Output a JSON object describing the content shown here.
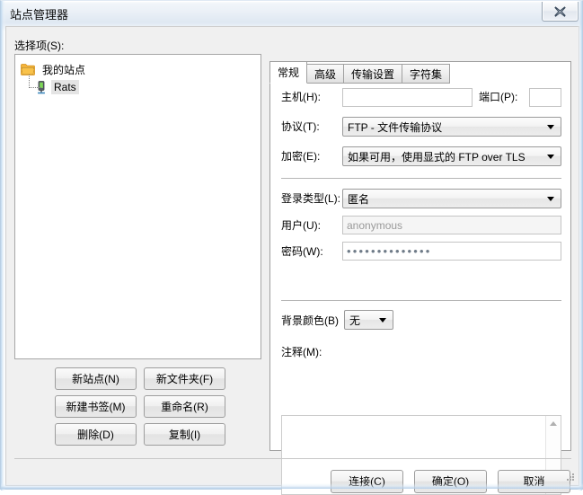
{
  "window": {
    "title": "站点管理器",
    "close_icon": "close-x-icon"
  },
  "left_pane": {
    "label": "选择项(S):",
    "tree": [
      {
        "label": "我的站点",
        "icon": "folder-icon",
        "selected": false
      },
      {
        "label": "Rats",
        "icon": "server-icon",
        "selected": true
      }
    ],
    "buttons": [
      {
        "label": "新站点(N)",
        "name": "new-site-button"
      },
      {
        "label": "新文件夹(F)",
        "name": "new-folder-button"
      },
      {
        "label": "新建书签(M)",
        "name": "new-bookmark-button"
      },
      {
        "label": "重命名(R)",
        "name": "rename-button"
      },
      {
        "label": "删除(D)",
        "name": "delete-button"
      },
      {
        "label": "复制(I)",
        "name": "duplicate-button"
      }
    ]
  },
  "right_pane": {
    "tabs": [
      {
        "label": "常规",
        "active": true
      },
      {
        "label": "高级",
        "active": false
      },
      {
        "label": "传输设置",
        "active": false
      },
      {
        "label": "字符集",
        "active": false
      }
    ],
    "general": {
      "host_label": "主机(H):",
      "host_value": "",
      "port_label": "端口(P):",
      "port_value": "",
      "protocol_label": "协议(T):",
      "protocol_value": "FTP - 文件传输协议",
      "encryption_label": "加密(E):",
      "encryption_value": "如果可用，使用显式的 FTP over TLS",
      "logontype_label": "登录类型(L):",
      "logontype_value": "匿名",
      "user_label": "用户(U):",
      "user_value": "anonymous",
      "password_label": "密码(W):",
      "password_value": "••••••••••••••",
      "bgcolor_label": "背景颜色(B)",
      "bgcolor_value": "无",
      "comments_label": "注释(M):",
      "comments_value": ""
    }
  },
  "footer": {
    "buttons": [
      {
        "label": "连接(C)",
        "name": "connect-button"
      },
      {
        "label": "确定(O)",
        "name": "ok-button"
      },
      {
        "label": "取消",
        "name": "cancel-button"
      }
    ]
  }
}
